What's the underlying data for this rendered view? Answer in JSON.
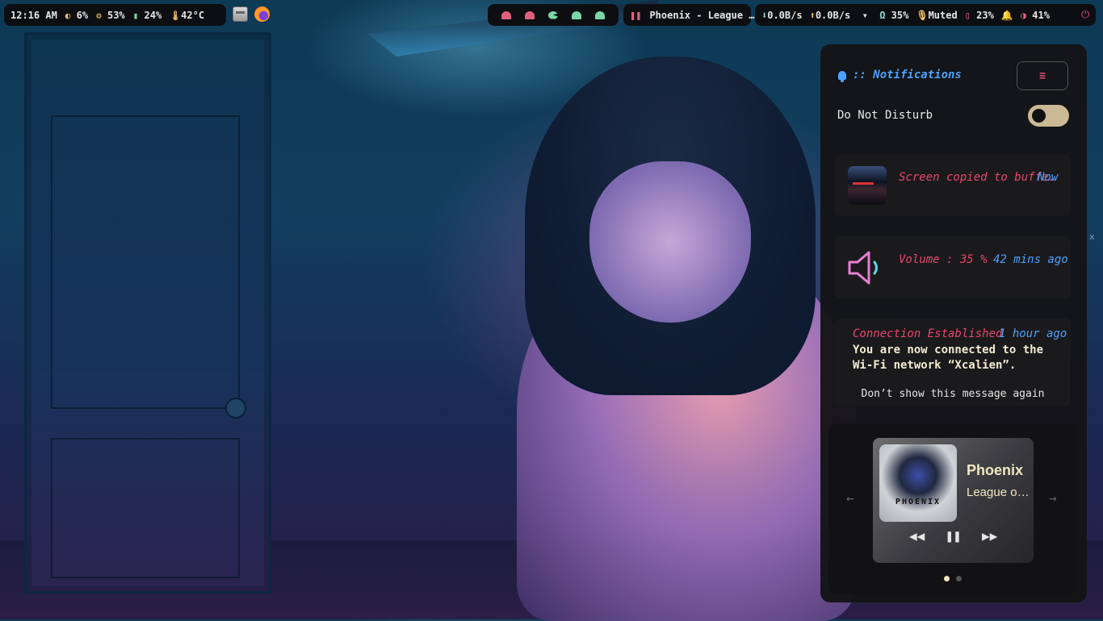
{
  "topbar": {
    "time": "12:16 AM",
    "brightness": "6%",
    "cpu": "53%",
    "memory": "24%",
    "temp": "42°C",
    "window_title": "Phoenix - League …",
    "download": "0.0B/s",
    "upload": "0.0B/s",
    "volume": "35%",
    "mic": "Muted",
    "battery": "23%",
    "night_light": "41%",
    "workspaces": [
      {
        "icon": "ghost-icon",
        "color": "#e0607b"
      },
      {
        "icon": "ghost-icon",
        "color": "#e0607b"
      },
      {
        "icon": "pacman-icon",
        "color": "#7ad6a6"
      },
      {
        "icon": "ghost-icon",
        "color": "#7ad6a6"
      },
      {
        "icon": "ghost-icon",
        "color": "#7ad6a6"
      }
    ]
  },
  "notifications": {
    "header": ":: Notifications",
    "clear_label": "≡",
    "dnd_label": "Do Not Disturb",
    "dnd_enabled": false,
    "items": [
      {
        "title": "Screen copied to buffe…",
        "time": "Now"
      },
      {
        "title": "Volume : 35 %",
        "time": "42 mins ago"
      },
      {
        "title": "Connection Established",
        "time": "1 hour ago",
        "body": "You are now connected to the Wi-Fi network “Xcalien”.",
        "action": "Don’t show this message again"
      }
    ]
  },
  "media": {
    "album_text": "PHOENIX",
    "title": "Phoenix",
    "artist": "League o…",
    "prev_arrow": "←",
    "next_arrow": "→",
    "rewind": "◀◀",
    "pause": "❚❚",
    "forward": "▶▶",
    "page_count": 2,
    "active_page": 1
  },
  "edge_glyph": "x",
  "colors": {
    "accent_blue": "#4ea0ff",
    "accent_pink": "#e8466f",
    "bar_bg": "#0d0e12",
    "panel_bg": "#141416"
  }
}
